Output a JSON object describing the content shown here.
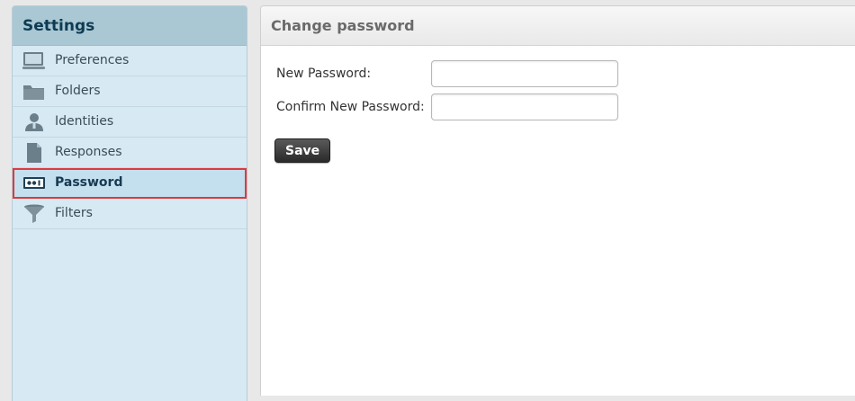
{
  "sidebar": {
    "title": "Settings",
    "items": [
      {
        "label": "Preferences",
        "icon": "monitor-icon"
      },
      {
        "label": "Folders",
        "icon": "folder-icon"
      },
      {
        "label": "Identities",
        "icon": "person-icon"
      },
      {
        "label": "Responses",
        "icon": "document-icon"
      },
      {
        "label": "Password",
        "icon": "password-icon",
        "selected": true
      },
      {
        "label": "Filters",
        "icon": "funnel-icon"
      }
    ]
  },
  "panel": {
    "title": "Change password",
    "fields": [
      {
        "label": "New Password:",
        "value": "",
        "placeholder": ""
      },
      {
        "label": "Confirm New Password:",
        "value": "",
        "placeholder": ""
      }
    ],
    "save_label": "Save"
  },
  "colors": {
    "selection_outline": "#e0393b",
    "sidebar_bg": "#d7e9f2",
    "sidebar_header_bg": "#a9c8d4"
  }
}
